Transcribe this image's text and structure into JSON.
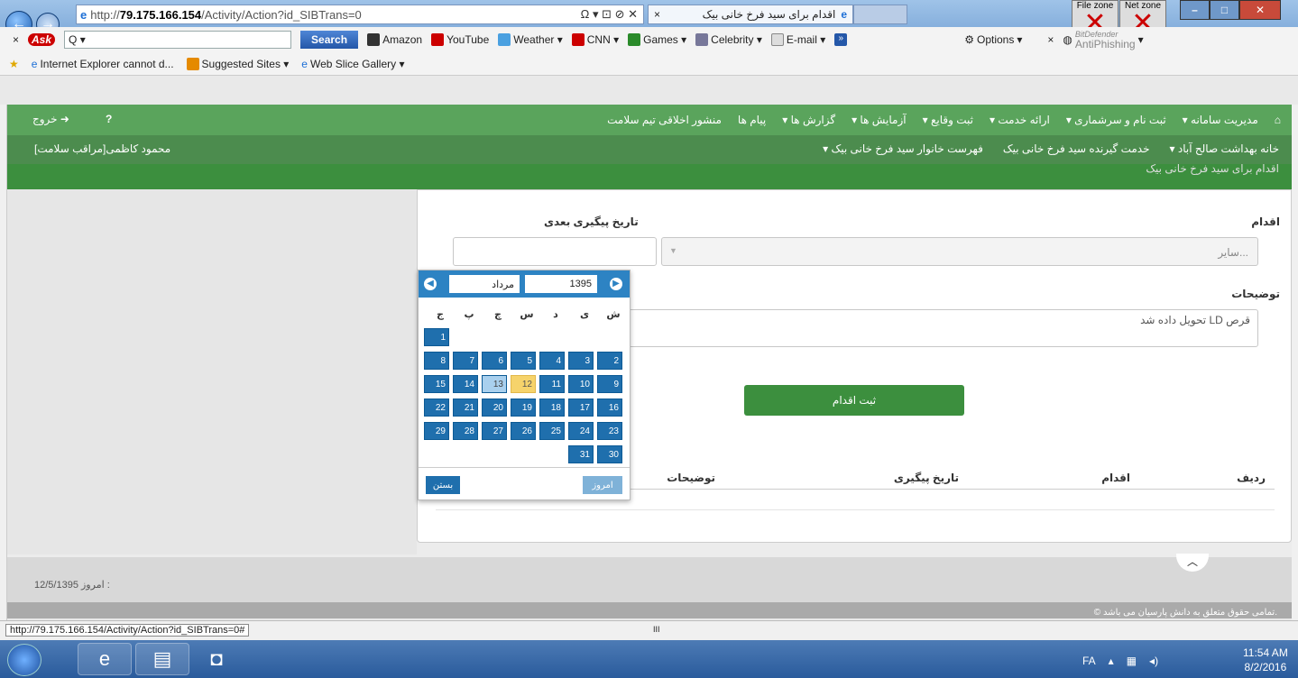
{
  "browser": {
    "url_prefix": "http://",
    "url_host": "79.175.166.154",
    "url_path": "/Activity/Action?id_SIBTrans=0",
    "address_controls": "Ω ▾ ⊡ ⊘ ✕",
    "tab_title": "اقدام برای سید فرخ خانی بیک",
    "tab_close": "×",
    "file_zone": "File zone",
    "net_zone": "Net zone",
    "status_url": "http://79.175.166.154/Activity/Action?id_SIBTrans=0#",
    "hscroll_mark": "III"
  },
  "toolbar": {
    "ask_logo": "Ask",
    "search_placeholder": "Q ▾",
    "search_label": "Search",
    "items": [
      "Amazon",
      "YouTube",
      "Weather ▾",
      "CNN ▾",
      "Games ▾",
      "Celebrity ▾",
      "E-mail ▾"
    ],
    "options": "Options",
    "antiphishing_brand": "BitDefender",
    "antiphishing": "AntiPhishing"
  },
  "favorites": {
    "items": [
      "Internet Explorer cannot d...",
      "Suggested Sites ▾",
      "Web Slice Gallery ▾"
    ]
  },
  "menu1": {
    "items": [
      "مدیریت سامانه ▾",
      "ثبت نام و سرشماری ▾",
      "ارائه خدمت ▾",
      "ثبت وقایع ▾",
      "آزمایش ها ▾",
      "گزارش ها ▾",
      "پیام ها",
      "منشور اخلاقی تیم سلامت"
    ],
    "logout": "خروج"
  },
  "menu2": {
    "items": [
      "خانه بهداشت صالح آباد ▾",
      "خدمت گیرنده سید فرخ خانی بیک",
      "فهرست خانوار سید فرخ خانی بیک ▾"
    ],
    "user": "محمود کاظمی[مراقب سلامت]"
  },
  "page": {
    "title": "اقدام برای سید فرخ خانی بیک",
    "action_label": "اقدام",
    "action_value": "سایر...",
    "next_date_label": "تاریخ پیگیری بعدی",
    "notes_label": "توضیحات",
    "notes_value": "قرص LD تحویل داده شد",
    "submit": "ثبت اقدام",
    "table_headers": [
      "ردیف",
      "اقدام",
      "تاریخ پیگیری",
      "توضیحات"
    ],
    "today_label": "امروز :",
    "today_value": "12/5/1395",
    "copyright": "© تمامی حقوق متعلق به دانش پارسیان می باشد."
  },
  "calendar": {
    "year": "1395",
    "month": "مرداد",
    "weekdays": [
      "ش",
      "ی",
      "د",
      "س",
      "چ",
      "پ",
      "ج"
    ],
    "rows": [
      [
        "",
        "",
        "",
        "",
        "",
        "",
        "1"
      ],
      [
        "2",
        "3",
        "4",
        "5",
        "6",
        "7",
        "8"
      ],
      [
        "9",
        "10",
        "11",
        "12",
        "13",
        "14",
        "15"
      ],
      [
        "16",
        "17",
        "18",
        "19",
        "20",
        "21",
        "22"
      ],
      [
        "23",
        "24",
        "25",
        "26",
        "27",
        "28",
        "29"
      ],
      [
        "30",
        "31",
        "",
        "",
        "",
        "",
        ""
      ]
    ],
    "today_btn": "امروز",
    "close_btn": "بستن",
    "today_day": "12",
    "hover_day": "13"
  },
  "taskbar": {
    "lang": "FA",
    "time": "11:54 AM",
    "date": "8/2/2016"
  }
}
